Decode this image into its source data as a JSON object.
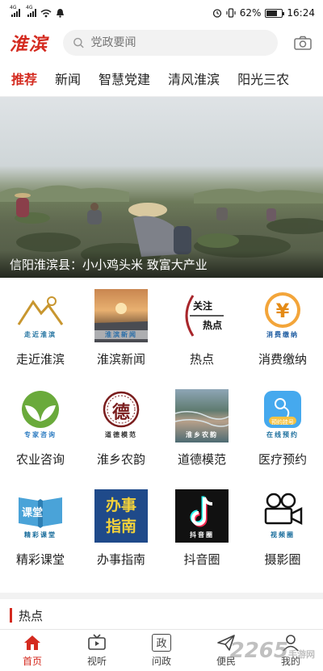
{
  "status_bar": {
    "net1": "4G",
    "net2": "4G",
    "battery": "62%",
    "time": "16:24"
  },
  "header": {
    "logo": "淮滨",
    "search_placeholder": "党政要闻"
  },
  "tabs": [
    {
      "label": "推荐",
      "active": true
    },
    {
      "label": "新闻"
    },
    {
      "label": "智慧党建"
    },
    {
      "label": "清风淮滨"
    },
    {
      "label": "阳光三农"
    }
  ],
  "banner": {
    "caption": "信阳淮滨县：小小鸡头米 致富大产业"
  },
  "grid": [
    {
      "label": "走近淮滨",
      "icon": "mountain-icon",
      "tag": "走近淮滨"
    },
    {
      "label": "淮滨新闻",
      "icon": "sunset-photo-icon",
      "tag": "淮滨新闻"
    },
    {
      "label": "热点",
      "icon": "focus-hotspot-icon",
      "tag_top": "关注",
      "tag": "热点"
    },
    {
      "label": "消费缴纳",
      "icon": "yuan-coin-icon",
      "tag": "消费缴纳"
    },
    {
      "label": "农业咨询",
      "icon": "leaf-icon",
      "tag": "专家咨询"
    },
    {
      "label": "淮乡农韵",
      "icon": "de-seal-icon",
      "seal": "德",
      "tag": "道德模范"
    },
    {
      "label": "道德模范",
      "icon": "terrace-photo-icon",
      "tag": "淮乡农韵"
    },
    {
      "label": "医疗预约",
      "icon": "medical-app-icon",
      "badge": "预约挂号",
      "tag": "在线预约"
    },
    {
      "label": "精彩课堂",
      "icon": "book-icon",
      "book": "课堂",
      "tag": "精彩课堂"
    },
    {
      "label": "办事指南",
      "icon": "guide-board-icon",
      "line1": "办事",
      "line2": "指南"
    },
    {
      "label": "抖音圈",
      "icon": "tiktok-icon",
      "tag": "抖音圈"
    },
    {
      "label": "摄影圈",
      "icon": "camera-icon",
      "tag": "视频圈"
    }
  ],
  "section": {
    "title": "热点"
  },
  "bottom_nav": [
    {
      "label": "首页",
      "icon": "home-icon",
      "active": true
    },
    {
      "label": "视听",
      "icon": "tv-icon"
    },
    {
      "label": "问政",
      "icon": "zheng-icon",
      "glyph": "政"
    },
    {
      "label": "便民",
      "icon": "paper-plane-icon"
    },
    {
      "label": "我的",
      "icon": "user-icon"
    }
  ],
  "watermark": {
    "brand": "2265",
    "site": "手游网"
  },
  "colors": {
    "accent": "#d42a1f",
    "caption_text": "#ffffff"
  }
}
